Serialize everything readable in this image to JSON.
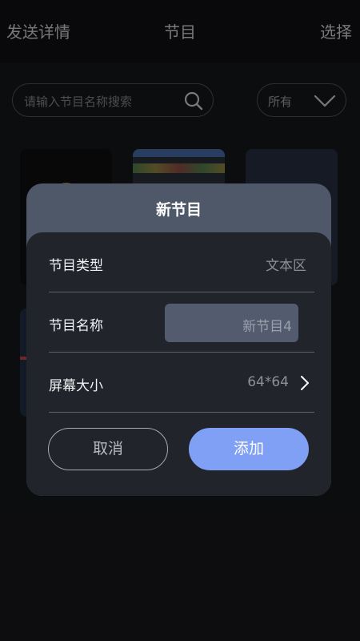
{
  "topbar": {
    "left_label": "发送详情",
    "title": "节目",
    "right_label": "选择"
  },
  "search": {
    "placeholder": "请输入节目名称搜索",
    "icon": "search-icon"
  },
  "filter": {
    "selected": "所有",
    "icon": "chevron-down-icon"
  },
  "dialog": {
    "title": "新节目",
    "rows": [
      {
        "label": "节目类型",
        "value": "文本区"
      },
      {
        "label": "节目名称",
        "value": "新节目4"
      },
      {
        "label": "屏幕大小",
        "value": "64*64"
      }
    ],
    "cancel_label": "取消",
    "add_label": "添加"
  },
  "colors": {
    "accent": "#7fa0f4",
    "dialog_header": "#4f5868",
    "dialog_body": "#22242b",
    "background": "#17181c"
  }
}
